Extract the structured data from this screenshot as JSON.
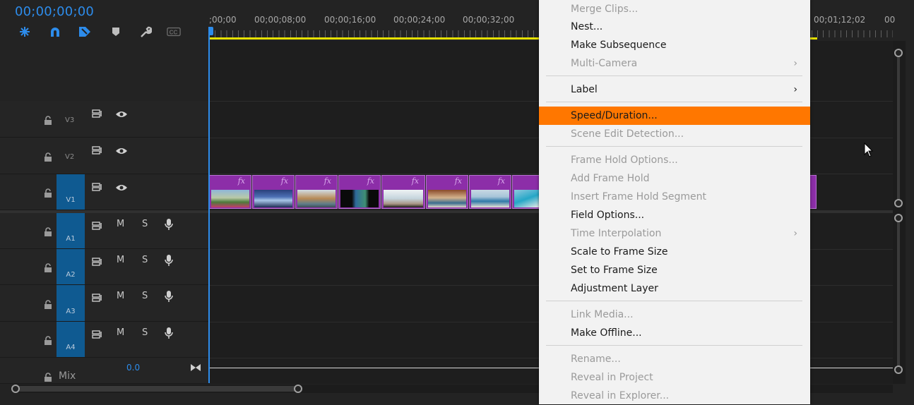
{
  "timecode": "00;00;00;00",
  "ruler_labels": [
    ";00;00",
    "00;00;08;00",
    "00;00;16;00",
    "00;00;24;00",
    "00;00;32;00",
    "00;01;12;02",
    "00"
  ],
  "video_tracks": [
    {
      "name": "V3",
      "locked_icon": "lock-icon"
    },
    {
      "name": "V2",
      "locked_icon": "lock-icon"
    },
    {
      "name": "V1",
      "locked_icon": "lock-icon"
    }
  ],
  "audio_tracks": [
    {
      "name": "A1",
      "m": "M",
      "s": "S"
    },
    {
      "name": "A2",
      "m": "M",
      "s": "S"
    },
    {
      "name": "A3",
      "m": "M",
      "s": "S"
    },
    {
      "name": "A4",
      "m": "M",
      "s": "S"
    }
  ],
  "mix": {
    "label": "Mix",
    "value": "0.0"
  },
  "clip_fx_label": "fx",
  "colors": {
    "accent": "#2d8ceb",
    "clip": "#8c2ea8",
    "menu_highlight": "#ff7700",
    "workarea": "#e6e000",
    "track_target": "#0f5a91"
  },
  "context_menu": {
    "items": [
      {
        "label": "Merge Clips...",
        "disabled": true
      },
      {
        "label": "Nest...",
        "disabled": false
      },
      {
        "label": "Make Subsequence",
        "disabled": false
      },
      {
        "label": "Multi-Camera",
        "disabled": true,
        "submenu": true
      },
      {
        "label": "Label",
        "disabled": false,
        "submenu": true
      },
      {
        "label": "Speed/Duration...",
        "disabled": false,
        "highlighted": true
      },
      {
        "label": "Scene Edit Detection...",
        "disabled": true
      },
      {
        "label": "Frame Hold Options...",
        "disabled": true
      },
      {
        "label": "Add Frame Hold",
        "disabled": true
      },
      {
        "label": "Insert Frame Hold Segment",
        "disabled": true
      },
      {
        "label": "Field Options...",
        "disabled": false
      },
      {
        "label": "Time Interpolation",
        "disabled": true,
        "submenu": true
      },
      {
        "label": "Scale to Frame Size",
        "disabled": false
      },
      {
        "label": "Set to Frame Size",
        "disabled": false
      },
      {
        "label": "Adjustment Layer",
        "disabled": false
      },
      {
        "label": "Link Media...",
        "disabled": true
      },
      {
        "label": "Make Offline...",
        "disabled": false
      },
      {
        "label": "Rename...",
        "disabled": true
      },
      {
        "label": "Reveal in Project",
        "disabled": true
      },
      {
        "label": "Reveal in Explorer...",
        "disabled": true
      }
    ],
    "submenu_arrow": "›"
  }
}
